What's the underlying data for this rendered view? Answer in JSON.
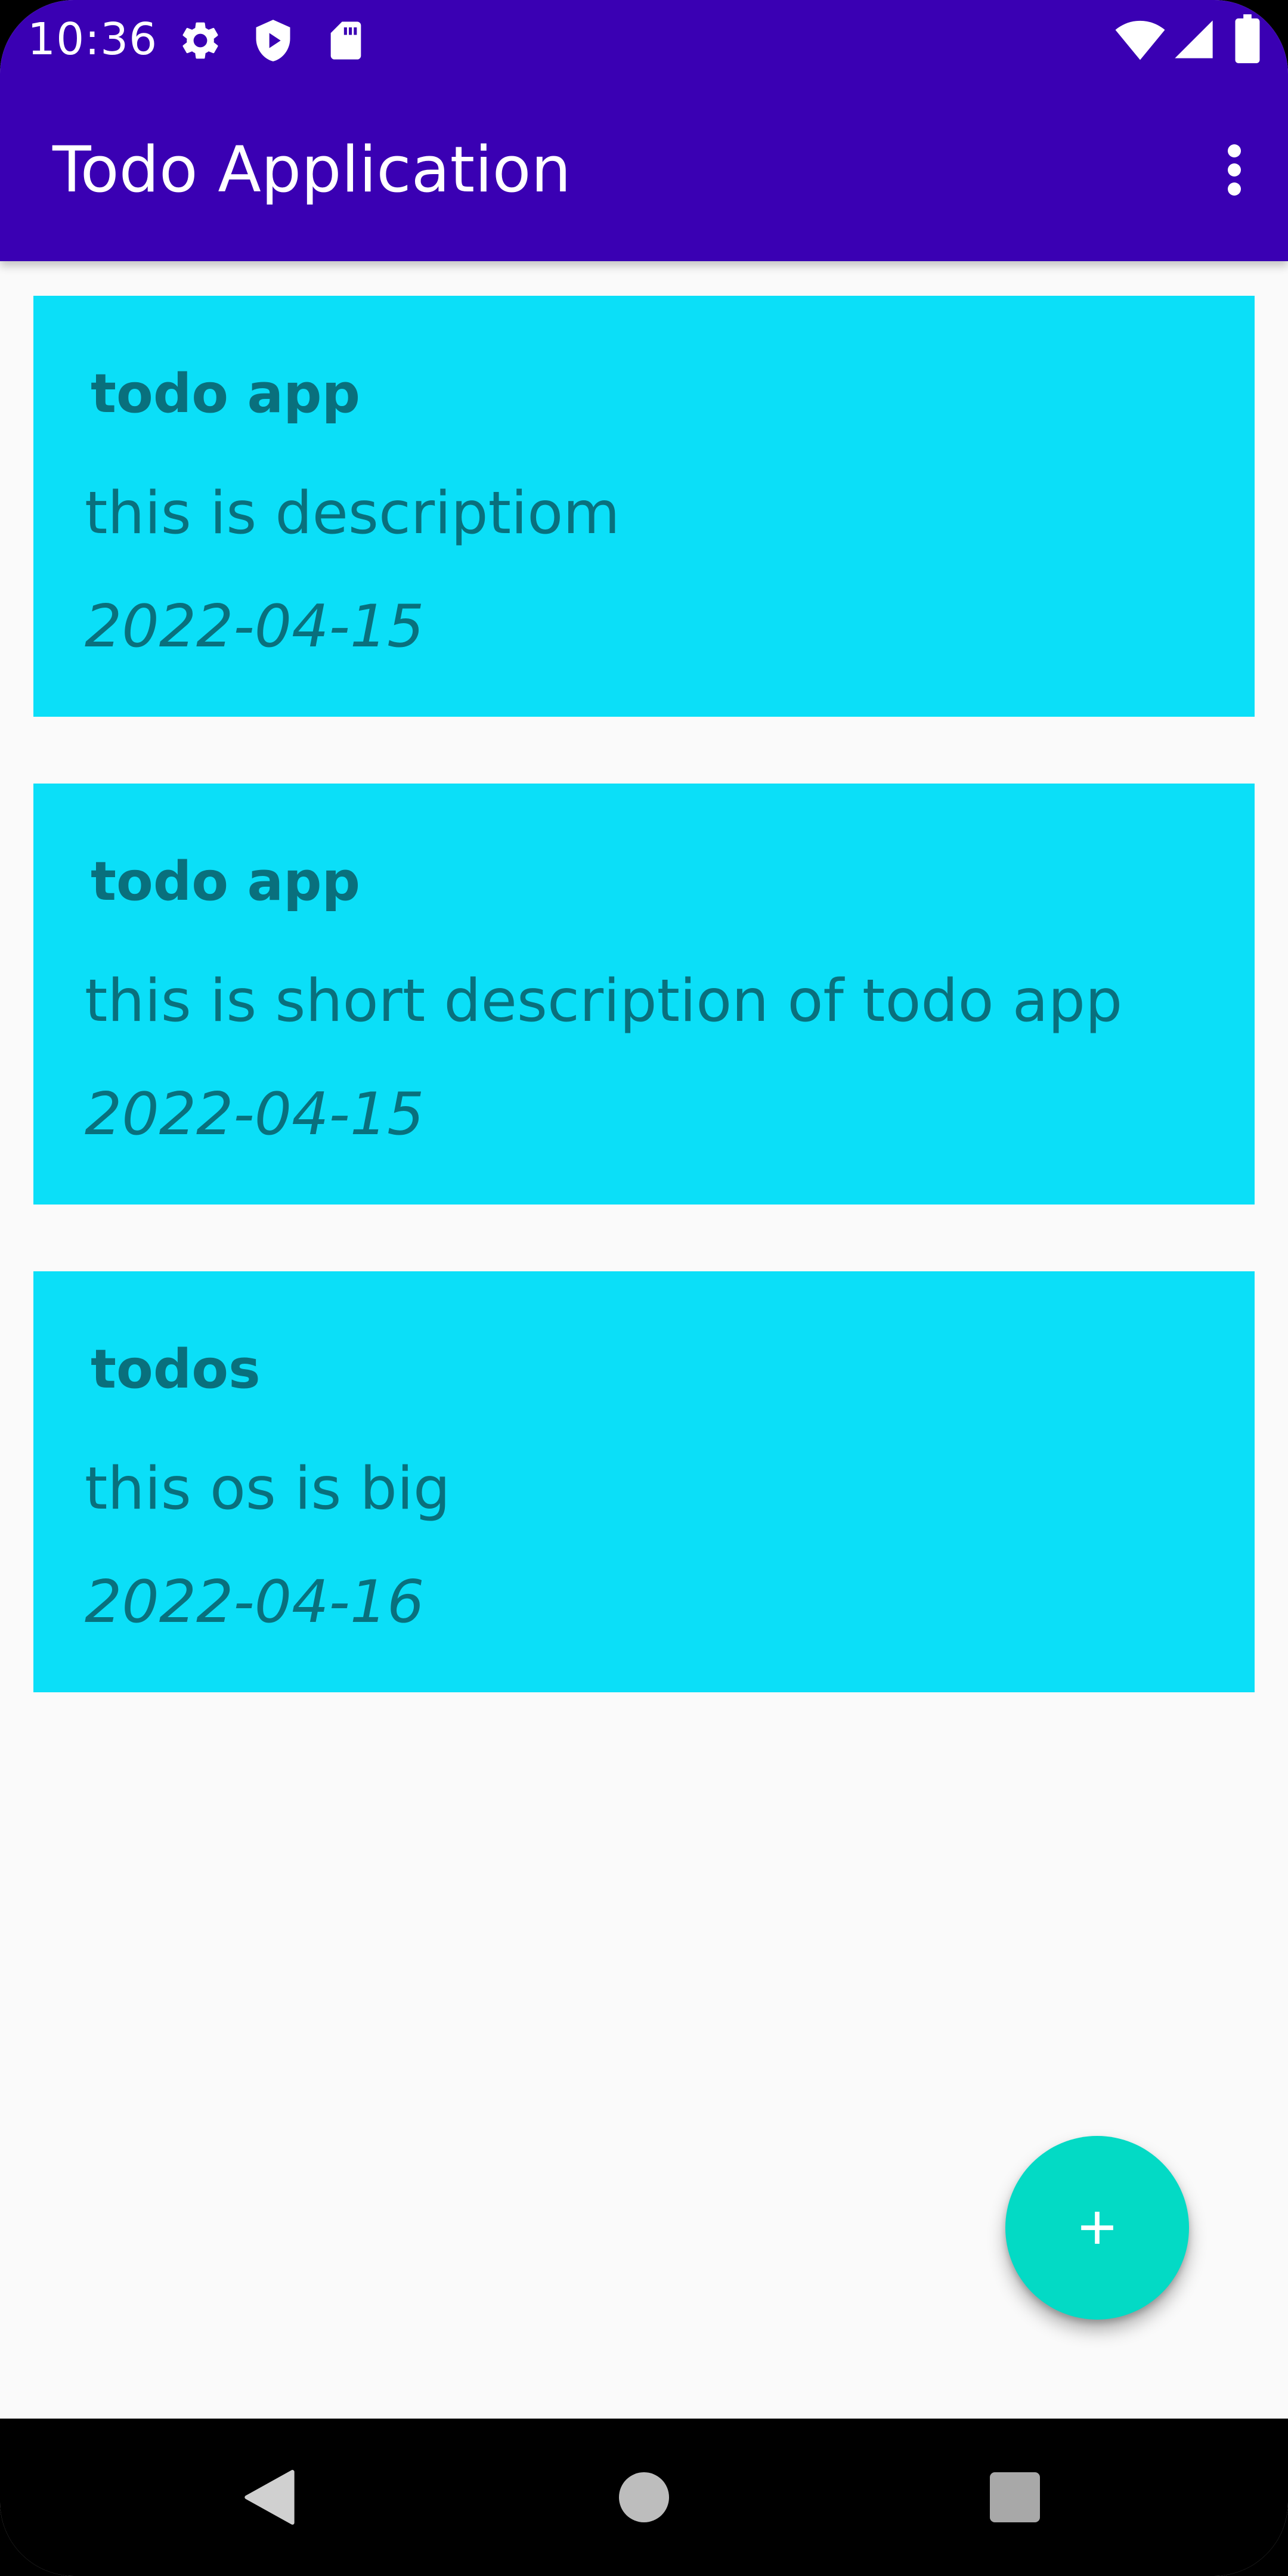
{
  "status_bar": {
    "time": "10:36",
    "left_icons": [
      "gear-icon",
      "shield-play-icon",
      "sd-card-icon"
    ],
    "right_icons": [
      "wifi-icon",
      "signal-icon",
      "battery-icon"
    ]
  },
  "app_bar": {
    "title": "Todo Application",
    "menu_icon": "more-vert-icon"
  },
  "todos": [
    {
      "title": "todo app",
      "description": "this is descriptiom",
      "date": "2022-04-15"
    },
    {
      "title": "todo app",
      "description": "this is short description of todo app",
      "date": "2022-04-15"
    },
    {
      "title": "todos",
      "description": "this os is big",
      "date": "2022-04-16"
    }
  ],
  "fab": {
    "icon": "plus-icon"
  },
  "nav_bar": {
    "buttons": [
      "back-icon",
      "home-icon",
      "recents-icon"
    ]
  },
  "colors": {
    "app_bar": "#3a00b3",
    "card_background": "#0bdff8",
    "card_text": "#09707d",
    "fab": "#03dac5",
    "page_background": "#fafafa"
  }
}
